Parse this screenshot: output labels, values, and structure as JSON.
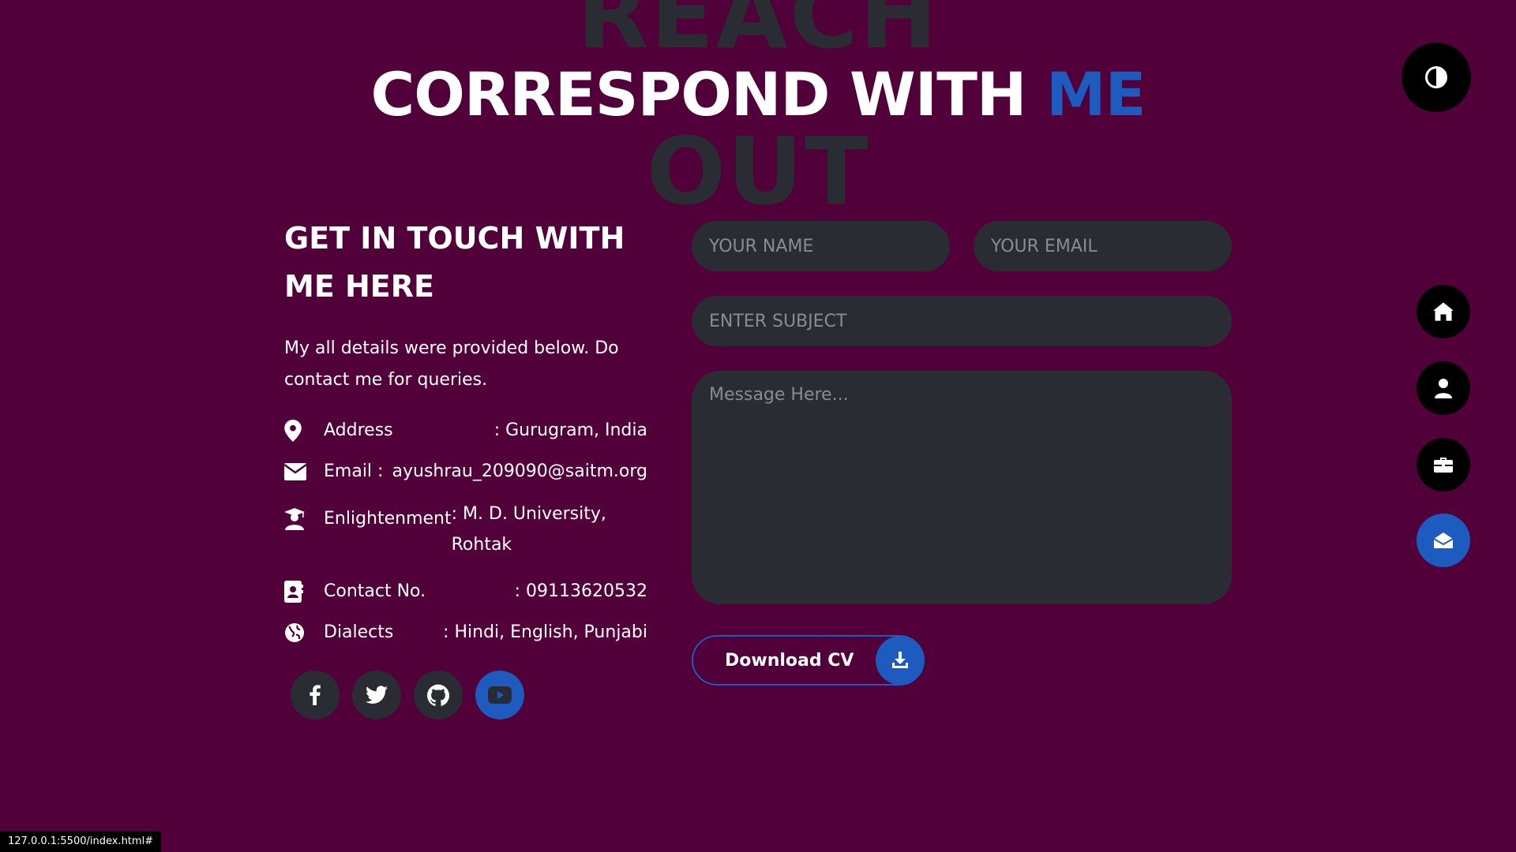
{
  "section": {
    "bg_word_top": "REACH",
    "bg_word_bottom": "OUT",
    "title_main": "CORRESPOND WITH",
    "title_accent": "ME"
  },
  "contact": {
    "heading": "GET IN TOUCH WITH ME HERE",
    "intro": "My all details were provided below. Do contact me for queries.",
    "details": [
      {
        "icon": "location-pin-icon",
        "label": "Address",
        "value": ": Gurugram, India"
      },
      {
        "icon": "envelope-icon",
        "label": "Email :",
        "value": "ayushrau_209090@saitm.org"
      },
      {
        "icon": "graduate-icon",
        "label": "Enlightenment",
        "value": ": M. D. University, Rohtak"
      },
      {
        "icon": "contact-card-icon",
        "label": "Contact No.",
        "value": ": 09113620532"
      },
      {
        "icon": "globe-icon",
        "label": "Dialects",
        "value": ": Hindi, English, Punjabi"
      }
    ],
    "social": [
      "facebook-icon",
      "twitter-icon",
      "github-icon",
      "youtube-icon"
    ]
  },
  "form": {
    "name_placeholder": "YOUR NAME",
    "email_placeholder": "YOUR EMAIL",
    "subject_placeholder": "ENTER SUBJECT",
    "message_placeholder": "Message Here...",
    "cv_label": "Download CV"
  },
  "nav": [
    "home-icon",
    "user-icon",
    "briefcase-icon",
    "mail-open-icon"
  ],
  "status_url": "127.0.0.1:5500/index.html#",
  "colors": {
    "background": "#51003a",
    "accent": "#1e5bbf",
    "panel": "#2a2c33"
  }
}
